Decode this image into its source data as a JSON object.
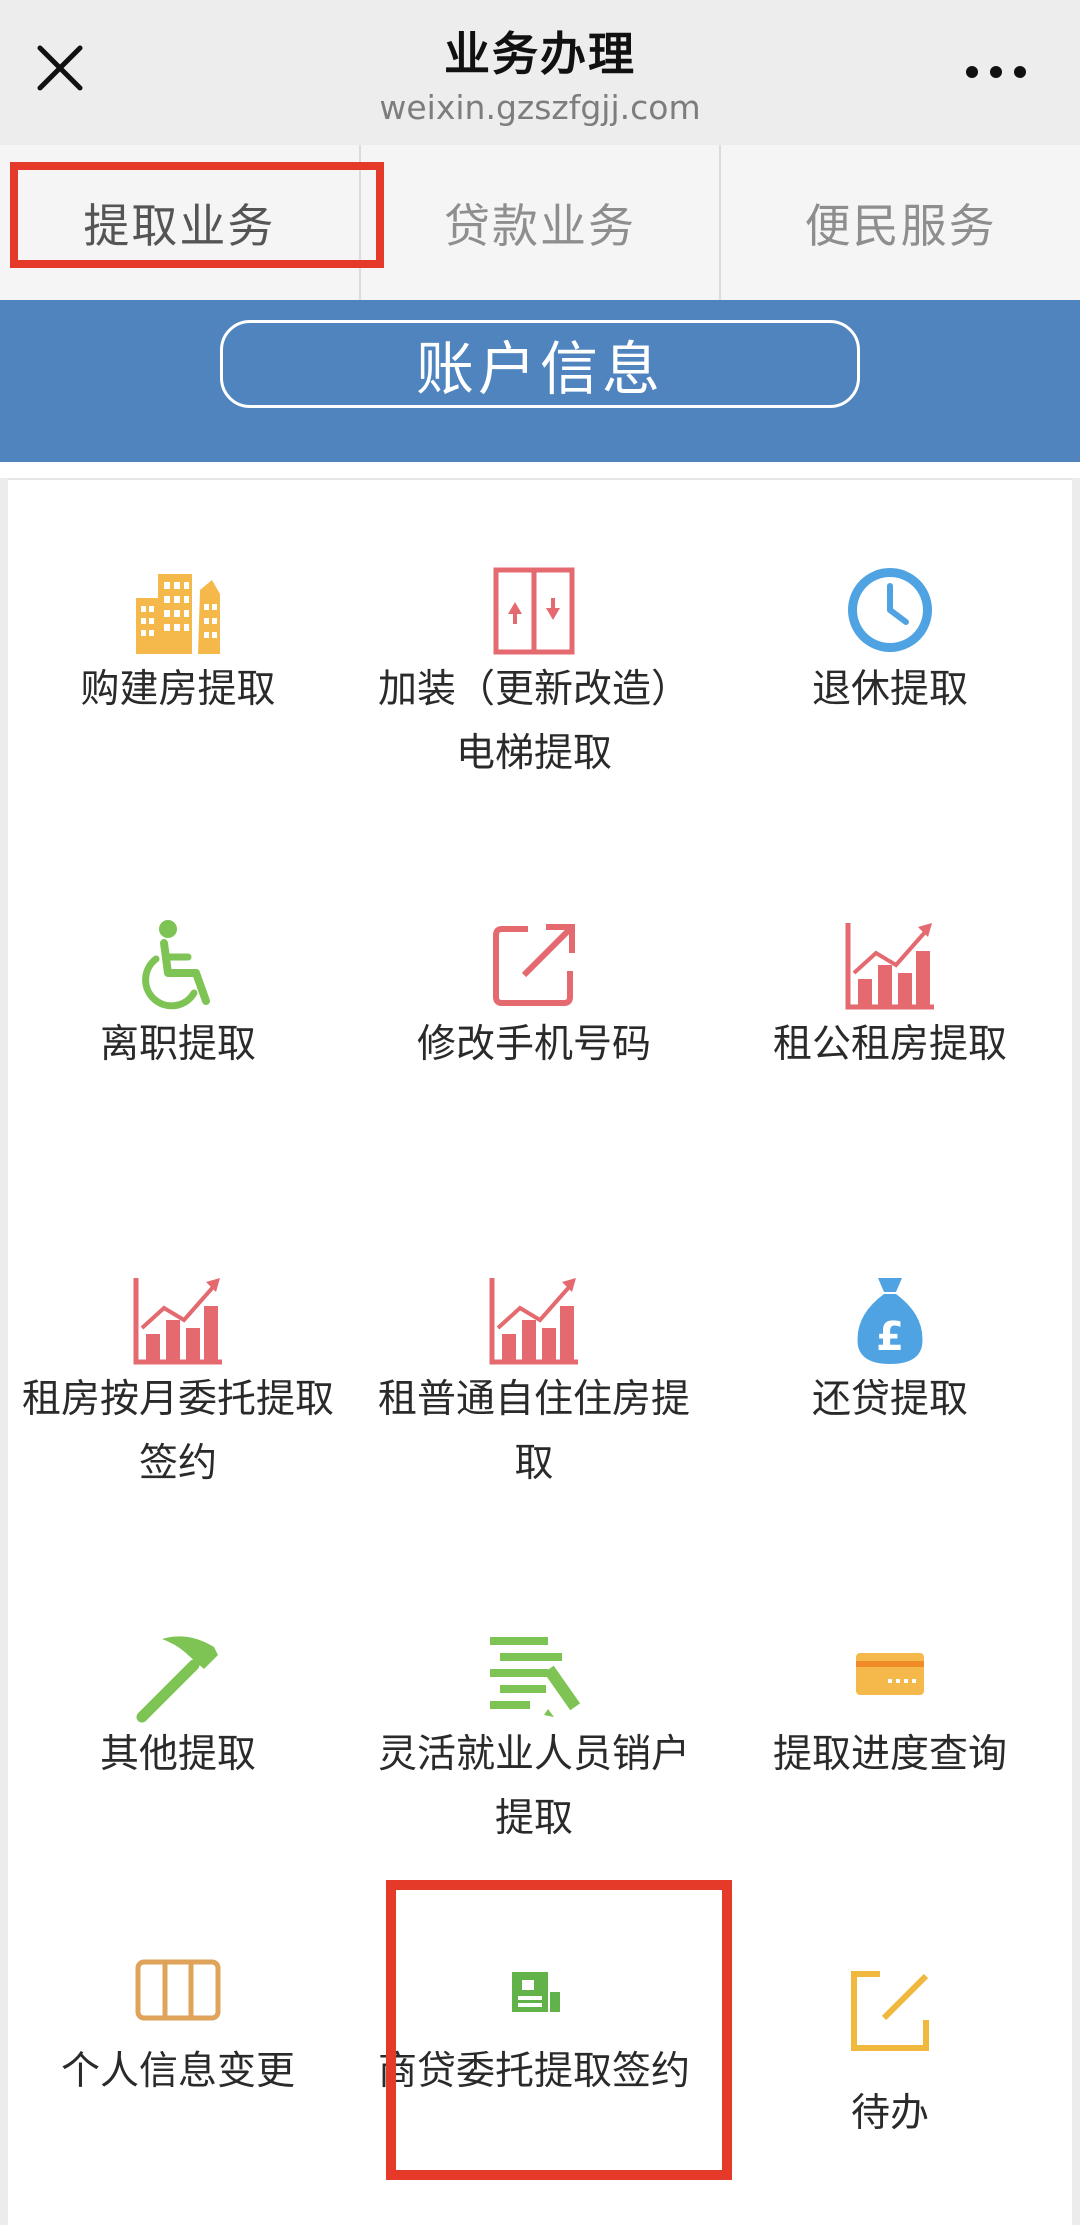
{
  "header": {
    "title": "业务办理",
    "url": "weixin.gzszfgjj.com",
    "close_icon": "close-icon",
    "more_icon": "more-icon"
  },
  "tabs": [
    {
      "label": "提取业务",
      "active": true
    },
    {
      "label": "贷款业务",
      "active": false
    },
    {
      "label": "便民服务",
      "active": false
    }
  ],
  "banner": {
    "label": "账户信息",
    "color": "#4f84bf"
  },
  "services": [
    {
      "label": "购建房提取",
      "icon": "buildings-icon",
      "color": "#f5b94b"
    },
    {
      "label": "加装（更新改造）电梯提取",
      "icon": "elevator-icon",
      "color": "#e46a6f"
    },
    {
      "label": "退休提取",
      "icon": "clock-icon",
      "color": "#4fa3e3"
    },
    {
      "label": "离职提取",
      "icon": "wheelchair-icon",
      "color": "#7ec454"
    },
    {
      "label": "修改手机号码",
      "icon": "edit-external-icon",
      "color": "#e46a6f"
    },
    {
      "label": "租公租房提取",
      "icon": "growth-chart-icon",
      "color": "#e46a6f"
    },
    {
      "label": "租房按月委托提取签约",
      "icon": "growth-chart-icon",
      "color": "#e46a6f"
    },
    {
      "label": "租普通自住住房提取",
      "icon": "growth-chart-icon",
      "color": "#e46a6f"
    },
    {
      "label": "还贷提取",
      "icon": "money-bag-icon",
      "color": "#4fa3e3"
    },
    {
      "label": "其他提取",
      "icon": "hammer-icon",
      "color": "#7ec454"
    },
    {
      "label": "灵活就业人员销户提取",
      "icon": "document-pen-icon",
      "color": "#7ec454"
    },
    {
      "label": "提取进度查询",
      "icon": "card-icon",
      "color": "#f5b94b"
    },
    {
      "label": "个人信息变更",
      "icon": "panels-icon",
      "color": "#e0a35c"
    },
    {
      "label": "商贷委托提取签约",
      "icon": "bank-card-icon",
      "color": "#62b24a"
    },
    {
      "label": "待办",
      "icon": "edit-icon",
      "color": "#f0b93d"
    }
  ]
}
